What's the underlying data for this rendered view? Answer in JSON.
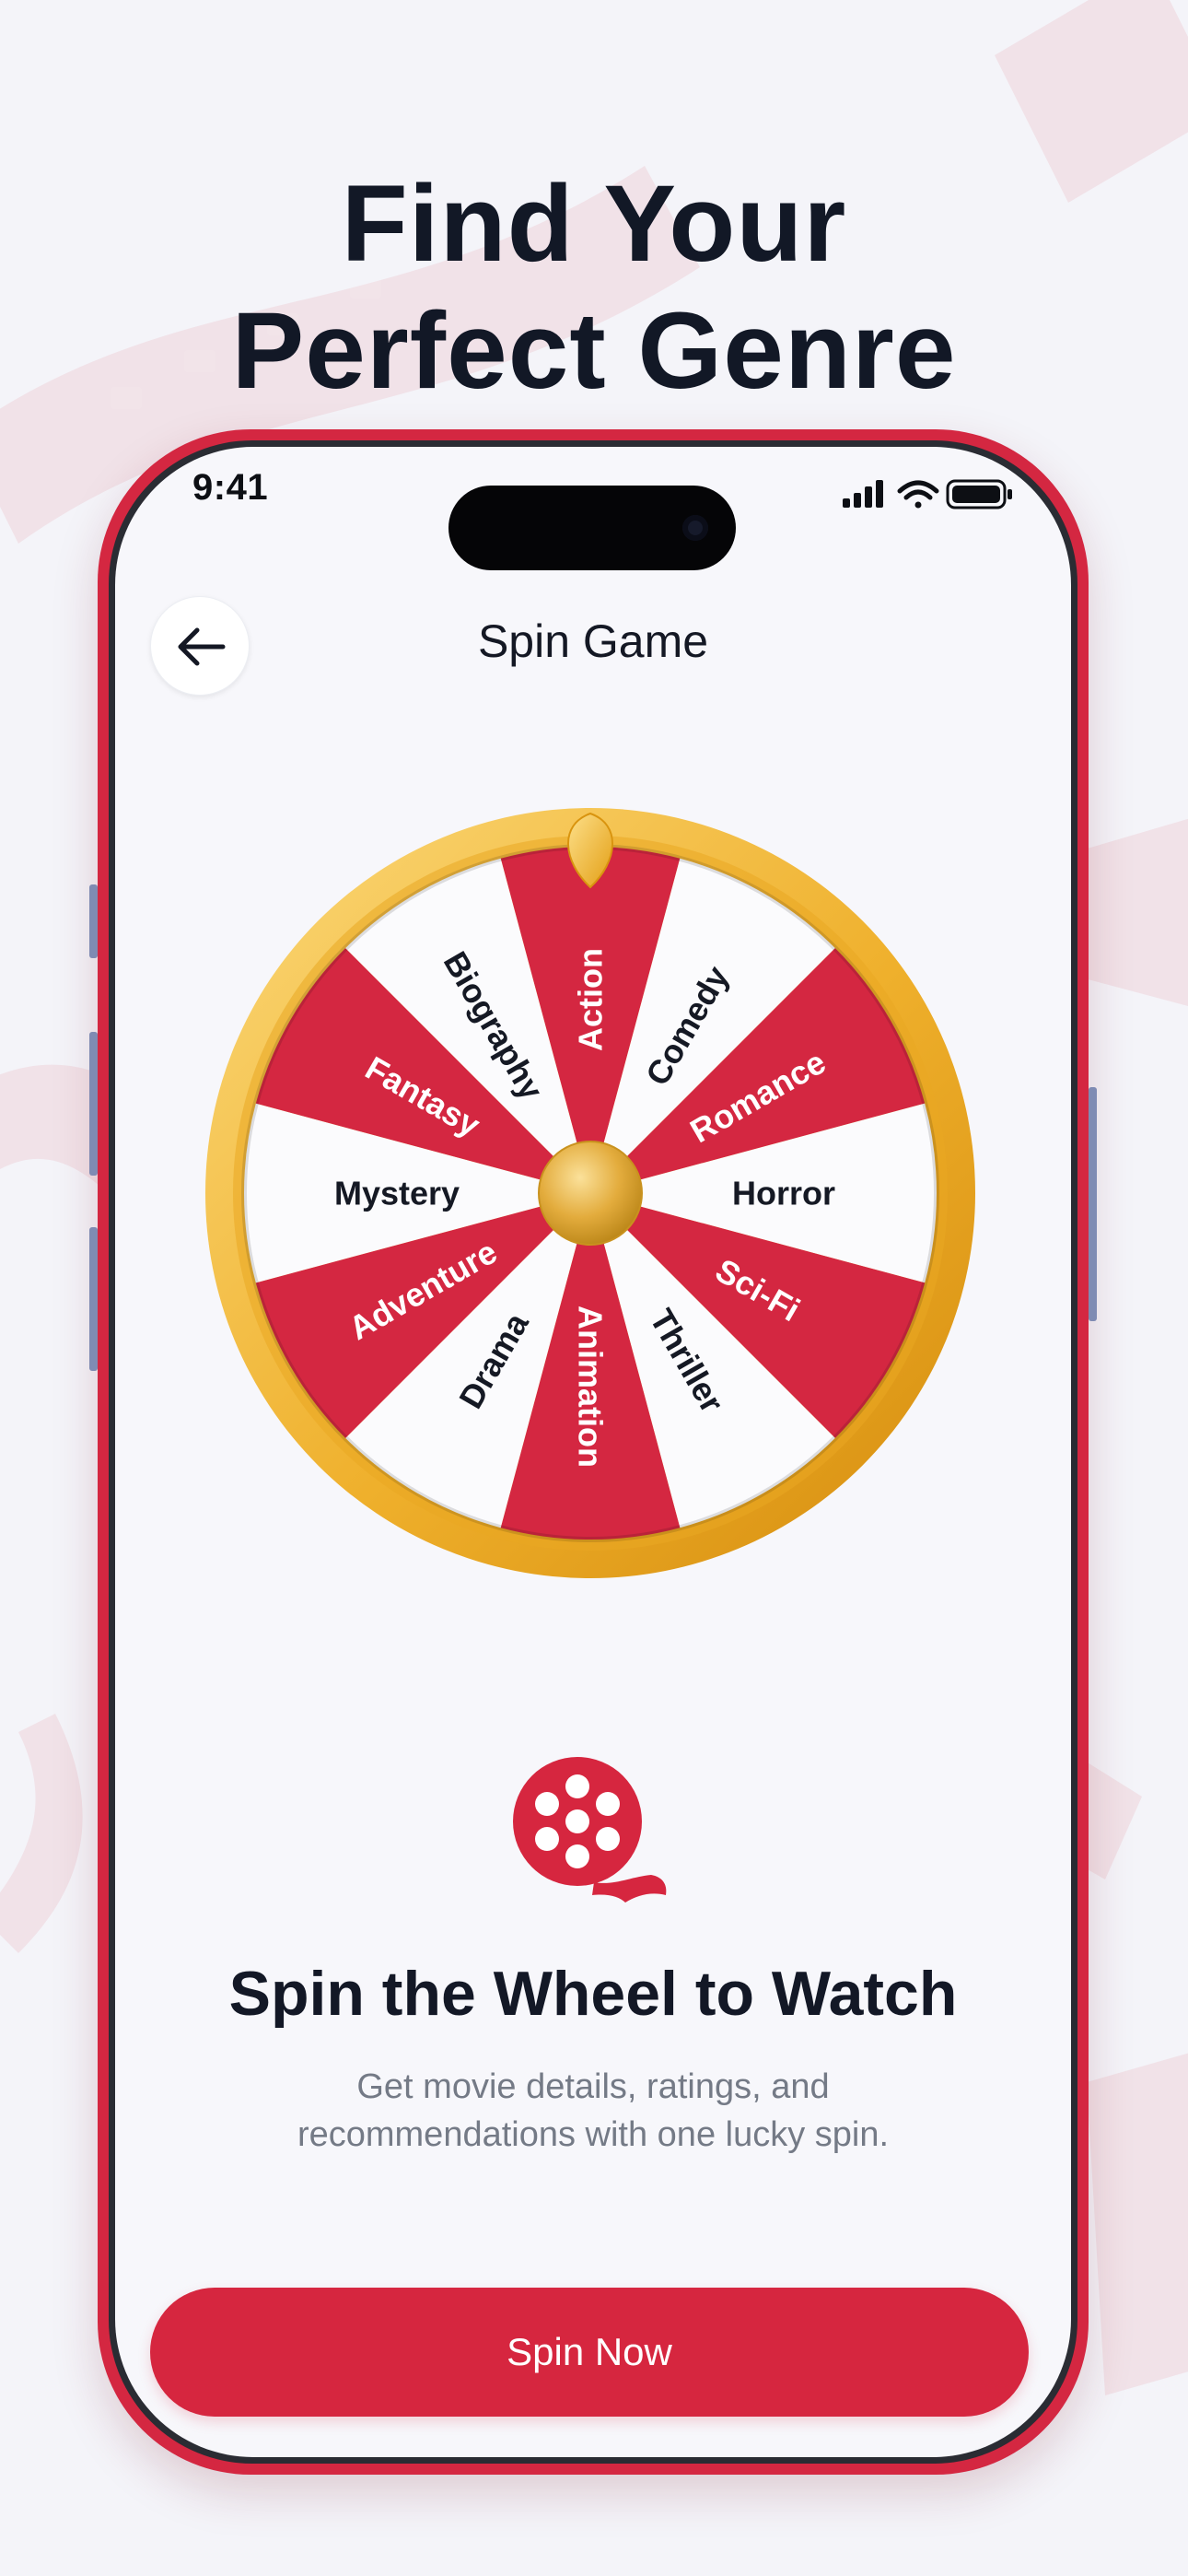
{
  "headline": {
    "line1": "Find Your",
    "line2": "Perfect Genre"
  },
  "status_bar": {
    "time": "9:41"
  },
  "header": {
    "title": "Spin Game"
  },
  "wheel": {
    "segments": [
      "Action",
      "Comedy",
      "Romance",
      "Horror",
      "Sci-Fi",
      "Thriller",
      "Animation",
      "Drama",
      "Adventure",
      "Mystery",
      "Fantasy",
      "Biography"
    ],
    "colors": {
      "red": "#d42741",
      "white": "#fbfbfd",
      "gold": "#f2b733",
      "gold_dark": "#d8900c"
    }
  },
  "cta": {
    "icon": "film-reel-icon",
    "title": "Spin the Wheel to Watch",
    "subtitle_line1": "Get movie details, ratings, and",
    "subtitle_line2": "recommendations with one lucky spin.",
    "button_label": "Spin Now"
  },
  "theme": {
    "accent": "#d6263f",
    "background": "#f4f4f9",
    "text_dark": "#121826",
    "text_muted": "#747a86"
  }
}
